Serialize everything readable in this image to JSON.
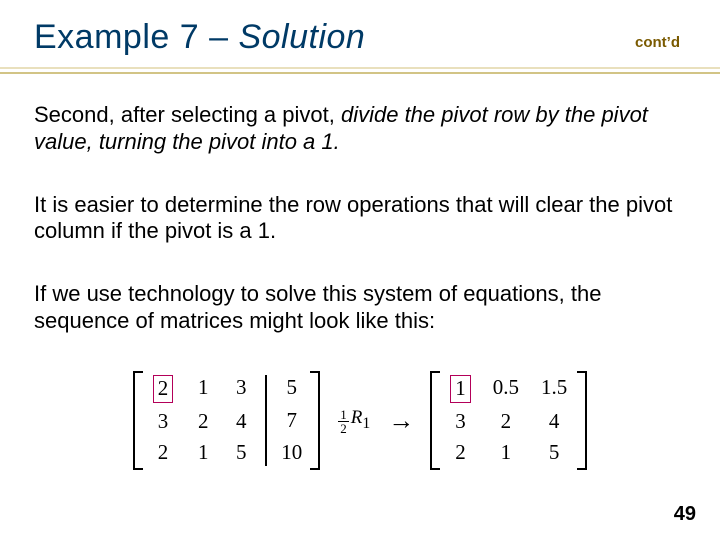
{
  "header": {
    "title_prefix": "Example 7 – ",
    "title_italic": "Solution",
    "contd": "cont’d"
  },
  "body": {
    "p1_a": "Second, after selecting a pivot, ",
    "p1_b": "divide the pivot row by the pivot value, turning the pivot into a 1.",
    "p2": "It is easier to determine the row operations that will clear the pivot column if the pivot is a 1.",
    "p3": "If we use technology to solve this system of equations, the sequence of matrices might look like this:"
  },
  "math": {
    "left": {
      "rows": [
        [
          "2",
          "1",
          "3"
        ],
        [
          "3",
          "2",
          "4"
        ],
        [
          "2",
          "1",
          "5"
        ]
      ],
      "aug": [
        "5",
        "7",
        "10"
      ],
      "pivot_cell": "2"
    },
    "op": {
      "frac_num": "1",
      "frac_den": "2",
      "R": "R",
      "sub": "1"
    },
    "arrow": "→",
    "right": {
      "rows": [
        [
          "1",
          "0.5",
          "1.5"
        ],
        [
          "3",
          "2",
          "4"
        ],
        [
          "2",
          "1",
          "5"
        ]
      ],
      "aug": [
        "",
        "",
        ""
      ],
      "pivot_cell": "1"
    }
  },
  "page": "49"
}
